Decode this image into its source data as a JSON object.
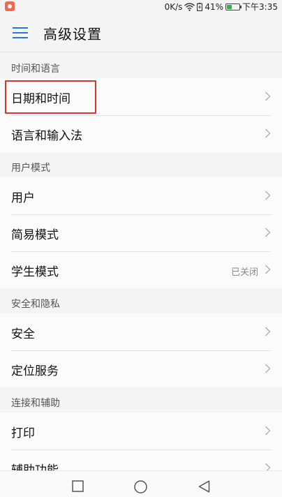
{
  "status_bar": {
    "net_speed": "0K/s",
    "battery_percent": "41%",
    "battery_level": 0.41,
    "time": "下午3:35",
    "icons": [
      "notification-icon",
      "wifi-icon",
      "battery-saver-icon",
      "battery-icon"
    ]
  },
  "header": {
    "title": "高级设置",
    "menu_icon": "menu-icon",
    "accent_color": "#1f7ad9"
  },
  "sections": [
    {
      "title": "时间和语言",
      "items": [
        {
          "label": "日期和时间"
        },
        {
          "label": "语言和输入法"
        }
      ]
    },
    {
      "title": "用户模式",
      "items": [
        {
          "label": "用户"
        },
        {
          "label": "简易模式"
        },
        {
          "label": "学生模式",
          "value": "已关闭"
        }
      ]
    },
    {
      "title": "安全和隐私",
      "items": [
        {
          "label": "安全"
        },
        {
          "label": "定位服务"
        }
      ]
    },
    {
      "title": "连接和辅助",
      "items": [
        {
          "label": "打印"
        },
        {
          "label": "辅助功能"
        }
      ]
    }
  ],
  "highlight_color": "#d9362e",
  "nav_bar": {
    "icons": [
      "recent-apps-icon",
      "home-icon",
      "back-icon"
    ]
  }
}
